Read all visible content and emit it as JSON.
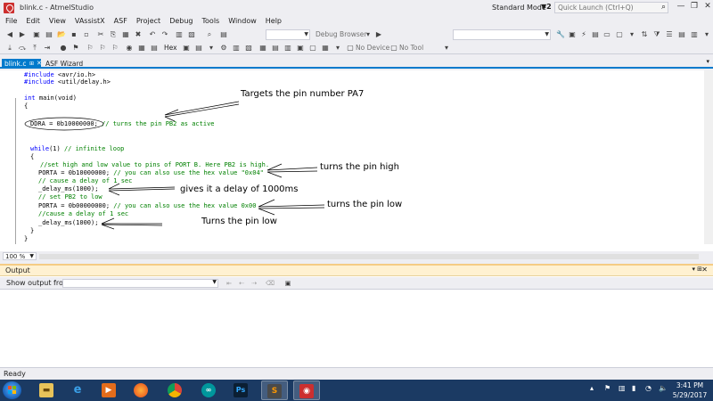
{
  "window": {
    "title": "blink.c - AtmelStudio",
    "layout": "Standard Mode",
    "quick_launch_placeholder": "Quick Launch (Ctrl+Q)",
    "filter_badge": "2"
  },
  "menu": [
    "File",
    "Edit",
    "View",
    "VAssistX",
    "ASF",
    "Project",
    "Debug",
    "Tools",
    "Window",
    "Help"
  ],
  "toolbar": {
    "debug_browser_label": "Debug Browser",
    "hex_label": "Hex",
    "no_device_label": "No Device",
    "no_tool_label": "No Tool"
  },
  "tabs": [
    {
      "label": "blink.c",
      "active": true
    },
    {
      "label": "ASF Wizard",
      "active": false
    }
  ],
  "editor": {
    "zoom": "100 %",
    "code": {
      "l1_kw": "#include",
      "l1_rest": " <avr/io.h>",
      "l2_kw": "#include",
      "l2_rest": " <util/delay.h>",
      "l3_kw": "int",
      "l3_rest": " main(void)",
      "l4": "{",
      "l5_code": "DDRA = 0b10000000; ",
      "l5_comment": "// turns the pin PB2 as active",
      "l6_kw": "while",
      "l6_code": "(1) ",
      "l6_comment": "// infinite loop",
      "l7": "{",
      "l8_comment": "//set high and low value to pins of PORT B. Here PB2 is high.",
      "l9_code": "PORTA = 0b10000000; ",
      "l9_comment": "// you can also use the hex value \"0x04\"",
      "l10_comment": "// cause a delay of 1 sec",
      "l11": "_delay_ms(1000);",
      "l12_comment": "// set PB2 to low",
      "l13_code": "PORTA = 0b00000000; ",
      "l13_comment": "// you can also use the hex value 0x00",
      "l14_comment": "//cause a delay of 1 sec",
      "l15": "_delay_ms(1000);",
      "l16": "}",
      "l17": "}"
    },
    "annotations": {
      "pa7": "Targets the pin number PA7",
      "high": "turns the pin high",
      "delay": "gives it a delay of 1000ms",
      "low1": "turns the pin low",
      "low2": "Turns the pin low"
    }
  },
  "output": {
    "title": "Output",
    "show_output_label": "Show output from:"
  },
  "status": {
    "text": "Ready"
  },
  "taskbar": {
    "time": "3:41 PM",
    "date": "5/29/2017"
  },
  "colors": {
    "accent": "#007acc",
    "keyword": "#0000ff",
    "comment": "#008000",
    "output_header": "#fff1d1",
    "taskbar": "#1b3a63"
  }
}
